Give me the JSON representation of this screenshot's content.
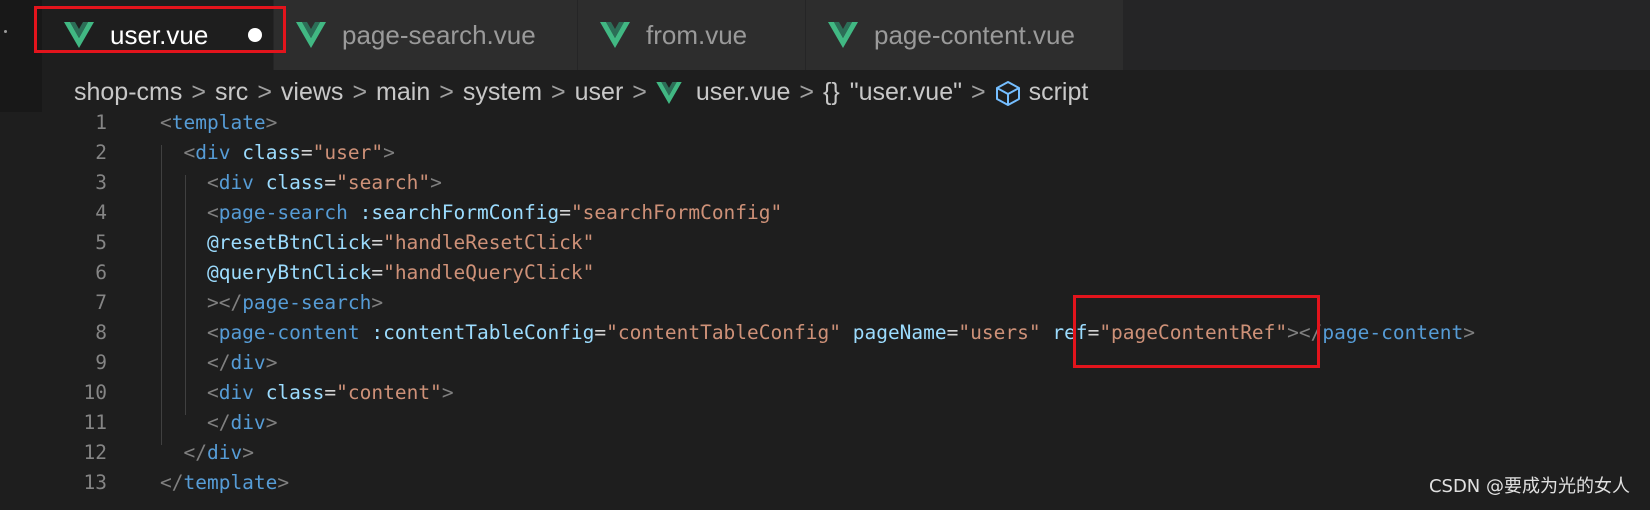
{
  "tabs": [
    {
      "label": "user.vue",
      "active": true,
      "modified": true
    },
    {
      "label": "page-search.vue",
      "active": false,
      "modified": false
    },
    {
      "label": "from.vue",
      "active": false,
      "modified": false
    },
    {
      "label": "page-content.vue",
      "active": false,
      "modified": false
    }
  ],
  "breadcrumb": {
    "items": [
      "shop-cms",
      "src",
      "views",
      "main",
      "system",
      "user"
    ],
    "file": "user.vue",
    "braces": "{}",
    "symbol": "\"user.vue\"",
    "section": "script",
    "separator": ">"
  },
  "code_lines": [
    {
      "num": "1",
      "tokens": [
        [
          "punc",
          "<"
        ],
        [
          "tag",
          "template"
        ],
        [
          "punc",
          ">"
        ]
      ]
    },
    {
      "num": "2",
      "tokens": [
        [
          "punc",
          "  <"
        ],
        [
          "tag",
          "div"
        ],
        [
          "op",
          " "
        ],
        [
          "attr",
          "class"
        ],
        [
          "op",
          "="
        ],
        [
          "str",
          "\"user\""
        ],
        [
          "punc",
          ">"
        ]
      ]
    },
    {
      "num": "3",
      "tokens": [
        [
          "punc",
          "    <"
        ],
        [
          "tag",
          "div"
        ],
        [
          "op",
          " "
        ],
        [
          "attr",
          "class"
        ],
        [
          "op",
          "="
        ],
        [
          "str",
          "\"search\""
        ],
        [
          "punc",
          ">"
        ]
      ]
    },
    {
      "num": "4",
      "tokens": [
        [
          "punc",
          "    <"
        ],
        [
          "tag",
          "page-search"
        ],
        [
          "op",
          " "
        ],
        [
          "attr",
          ":searchFormConfig"
        ],
        [
          "op",
          "="
        ],
        [
          "str",
          "\"searchFormConfig\""
        ]
      ]
    },
    {
      "num": "5",
      "tokens": [
        [
          "attr",
          "    @resetBtnClick"
        ],
        [
          "op",
          "="
        ],
        [
          "str",
          "\"handleResetClick\""
        ]
      ]
    },
    {
      "num": "6",
      "tokens": [
        [
          "attr",
          "    @queryBtnClick"
        ],
        [
          "op",
          "="
        ],
        [
          "str",
          "\"handleQueryClick\""
        ]
      ]
    },
    {
      "num": "7",
      "tokens": [
        [
          "punc",
          "    ></"
        ],
        [
          "tag",
          "page-search"
        ],
        [
          "punc",
          ">"
        ]
      ]
    },
    {
      "num": "8",
      "tokens": [
        [
          "punc",
          "    <"
        ],
        [
          "tag",
          "page-content"
        ],
        [
          "op",
          " "
        ],
        [
          "attr",
          ":contentTableConfig"
        ],
        [
          "op",
          "="
        ],
        [
          "str",
          "\"contentTableConfig\""
        ],
        [
          "op",
          " "
        ],
        [
          "attr",
          "pageName"
        ],
        [
          "op",
          "="
        ],
        [
          "str",
          "\"users\""
        ],
        [
          "op",
          " "
        ],
        [
          "attr",
          "ref"
        ],
        [
          "op",
          "="
        ],
        [
          "str",
          "\"pageContentRef\""
        ],
        [
          "punc",
          "></"
        ],
        [
          "tag",
          "page-content"
        ],
        [
          "punc",
          ">"
        ]
      ]
    },
    {
      "num": "9",
      "tokens": [
        [
          "punc",
          "    </"
        ],
        [
          "tag",
          "div"
        ],
        [
          "punc",
          ">"
        ]
      ]
    },
    {
      "num": "10",
      "tokens": [
        [
          "punc",
          "    <"
        ],
        [
          "tag",
          "div"
        ],
        [
          "op",
          " "
        ],
        [
          "attr",
          "class"
        ],
        [
          "op",
          "="
        ],
        [
          "str",
          "\"content\""
        ],
        [
          "punc",
          ">"
        ]
      ]
    },
    {
      "num": "11",
      "tokens": [
        [
          "punc",
          "    </"
        ],
        [
          "tag",
          "div"
        ],
        [
          "punc",
          ">"
        ]
      ]
    },
    {
      "num": "12",
      "tokens": [
        [
          "punc",
          "  </"
        ],
        [
          "tag",
          "div"
        ],
        [
          "punc",
          ">"
        ]
      ]
    },
    {
      "num": "13",
      "tokens": [
        [
          "punc",
          "</"
        ],
        [
          "tag",
          "template"
        ],
        [
          "punc",
          ">"
        ]
      ]
    }
  ],
  "watermark": "CSDN @要成为光的女人",
  "colors": {
    "background": "#1e1e1e",
    "tab_inactive": "#2d2d2d",
    "vue_green": "#41b883",
    "tag": "#569cd6",
    "attr": "#9cdcfe",
    "string": "#ce9178",
    "punctuation": "#808080",
    "highlight_box": "#e3141c"
  },
  "icons": {
    "tab_icon": "vue-logo-icon",
    "breadcrumb_file_icon": "vue-logo-icon",
    "breadcrumb_section_icon": "cube-icon"
  }
}
